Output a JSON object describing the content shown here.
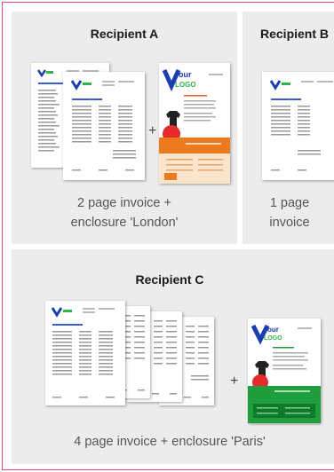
{
  "panels": {
    "a": {
      "title": "Recipient A",
      "caption_line1": "2 page invoice +",
      "caption_line2": "enclosure 'London'"
    },
    "b": {
      "title": "Recipient B",
      "caption_line1": "1 page",
      "caption_line2": "invoice"
    },
    "c": {
      "title": "Recipient C",
      "caption": "4 page invoice + enclosure 'Paris'"
    }
  },
  "plus_sign": "+",
  "logo": {
    "line1": "our",
    "line2": "LOGO"
  },
  "colors": {
    "logo_blue": "#1a3fb0",
    "logo_green": "#2fb34a",
    "london_orange": "#ee7a1e",
    "paris_green": "#1e9e3c",
    "border_pink": "#d8507a"
  }
}
